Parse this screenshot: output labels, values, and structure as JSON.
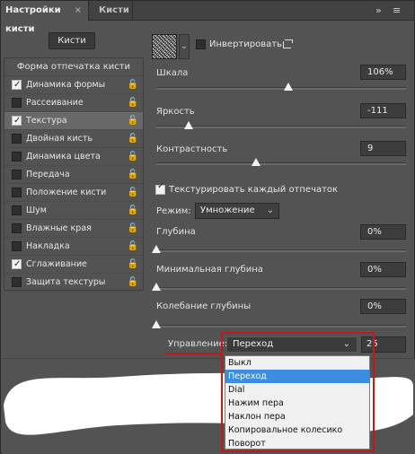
{
  "tabs": {
    "active_label": "Настройки кисти",
    "close_label": "×",
    "inactive_label": "Кисти",
    "more_glyph": "»",
    "menu_glyph": "≡"
  },
  "brushes_button": "Кисти",
  "left_panel": {
    "header": "Форма отпечатка кисти",
    "items": [
      {
        "label": "Динамика формы",
        "checked": true,
        "locked": true
      },
      {
        "label": "Рассеивание",
        "checked": false,
        "locked": true
      },
      {
        "label": "Текстура",
        "checked": true,
        "locked": true,
        "selected": true
      },
      {
        "label": "Двойная кисть",
        "checked": false,
        "locked": true
      },
      {
        "label": "Динамика цвета",
        "checked": false,
        "locked": true
      },
      {
        "label": "Передача",
        "checked": false,
        "locked": true
      },
      {
        "label": "Положение кисти",
        "checked": false,
        "locked": true
      },
      {
        "label": "Шум",
        "checked": false,
        "locked": true
      },
      {
        "label": "Влажные края",
        "checked": false,
        "locked": true
      },
      {
        "label": "Накладка",
        "checked": false,
        "locked": true
      },
      {
        "label": "Сглаживание",
        "checked": true,
        "locked": true
      },
      {
        "label": "Защита текстуры",
        "checked": false,
        "locked": true
      }
    ],
    "lock_glyph": "🔓"
  },
  "texture": {
    "dropdown_glyph": "⌄",
    "invert_label": "Инвертировать",
    "invert_checked": false,
    "scale": {
      "label": "Шкала",
      "value": "106%",
      "level": 0.53
    },
    "brightness": {
      "label": "Яркость",
      "value": "-111",
      "level": 0.13
    },
    "contrast": {
      "label": "Контрастность",
      "value": "9",
      "level": 0.4
    },
    "texture_each_tip": {
      "label": "Текстурировать каждый отпечаток",
      "checked": true
    },
    "mode": {
      "label": "Режим:",
      "value": "Умножение",
      "chevron": "⌄"
    },
    "depth": {
      "label": "Глубина",
      "value": "0%",
      "level": 0
    },
    "min_depth": {
      "label": "Минимальная глубина",
      "value": "0%",
      "level": 0
    },
    "depth_jitter": {
      "label": "Колебание глубины",
      "value": "0%",
      "level": 0
    },
    "control": {
      "label": "Управление:",
      "value": "Переход",
      "chevron": "⌄",
      "number": "25"
    }
  },
  "control_options": [
    {
      "label": "Выкл",
      "highlighted": false
    },
    {
      "label": "Переход",
      "highlighted": true
    },
    {
      "label": "Dial",
      "highlighted": false
    },
    {
      "label": "Нажим пера",
      "highlighted": false
    },
    {
      "label": "Наклон пера",
      "highlighted": false
    },
    {
      "label": "Копировальное колесико",
      "highlighted": false
    },
    {
      "label": "Поворот",
      "highlighted": false
    }
  ],
  "colors": {
    "panel_bg": "#535353",
    "highlight": "#3c8de0",
    "annotation_red": "#c21a1a"
  }
}
